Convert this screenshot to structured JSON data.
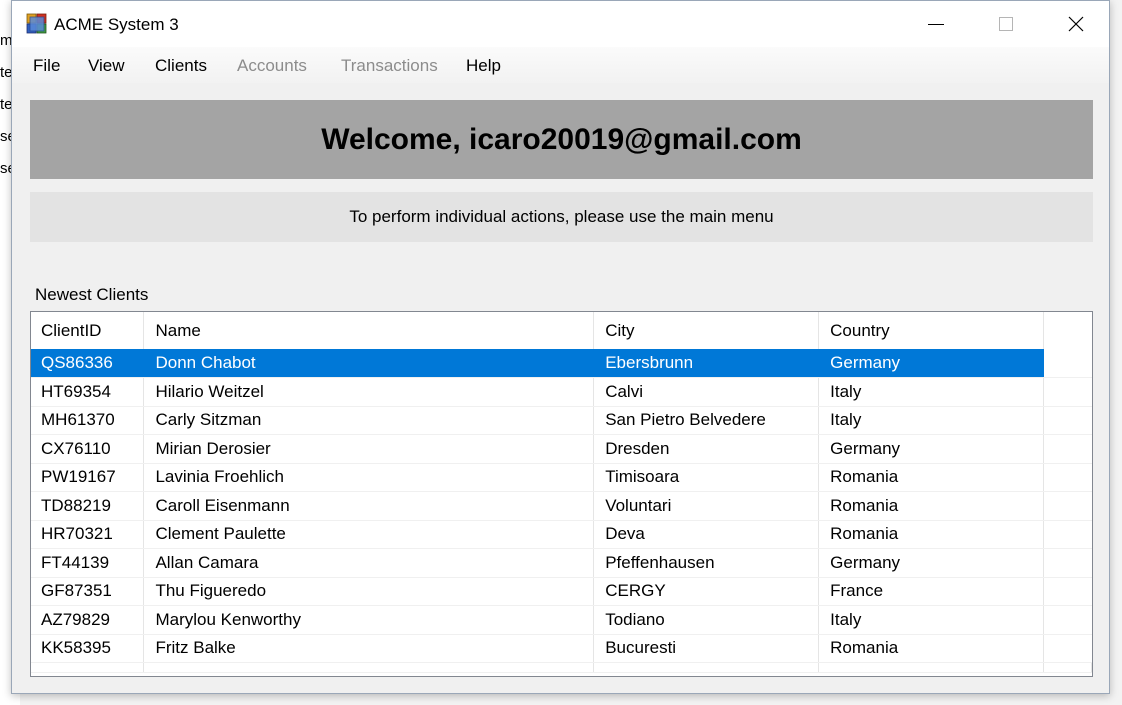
{
  "background_app": {
    "fragments": [
      "m",
      "te",
      "te",
      "se",
      "se"
    ]
  },
  "window": {
    "title": "ACME System 3",
    "icon": "app-window-icon",
    "controls": {
      "minimize_icon": "minimize-icon",
      "maximize_icon": "maximize-icon",
      "close_icon": "close-icon"
    }
  },
  "menu": {
    "items": [
      {
        "label": "File",
        "enabled": true
      },
      {
        "label": "View",
        "enabled": true
      },
      {
        "label": "Clients",
        "enabled": true
      },
      {
        "label": "Accounts",
        "enabled": false
      },
      {
        "label": "Transactions",
        "enabled": false
      },
      {
        "label": "Help",
        "enabled": true
      }
    ]
  },
  "welcome": {
    "text": "Welcome, icaro20019@gmail.com"
  },
  "info": {
    "text": "To perform individual actions, please use the main menu"
  },
  "clients": {
    "section_label": "Newest Clients",
    "columns": [
      "ClientID",
      "Name",
      "City",
      "Country"
    ],
    "selected_index": 0,
    "rows": [
      [
        "QS86336",
        "Donn Chabot",
        "Ebersbrunn",
        "Germany"
      ],
      [
        "HT69354",
        "Hilario Weitzel",
        "Calvi",
        "Italy"
      ],
      [
        "MH61370",
        "Carly Sitzman",
        "San Pietro Belvedere",
        "Italy"
      ],
      [
        "CX76110",
        "Mirian Derosier",
        "Dresden",
        "Germany"
      ],
      [
        "PW19167",
        "Lavinia Froehlich",
        "Timisoara",
        "Romania"
      ],
      [
        "TD88219",
        "Caroll Eisenmann",
        "Voluntari",
        "Romania"
      ],
      [
        "HR70321",
        "Clement Paulette",
        "Deva",
        "Romania"
      ],
      [
        "FT44139",
        "Allan Camara",
        "Pfeffenhausen",
        "Germany"
      ],
      [
        "GF87351",
        "Thu Figueredo",
        "CERGY",
        "France"
      ],
      [
        "AZ79829",
        "Marylou Kenworthy",
        "Todiano",
        "Italy"
      ],
      [
        "KK58395",
        "Fritz Balke",
        "Bucuresti",
        "Romania"
      ]
    ]
  },
  "colors": {
    "selection": "#0078d7",
    "banner": "#a4a4a4",
    "info_bar": "#e3e3e3",
    "disabled_menu": "#8c8c8c"
  }
}
